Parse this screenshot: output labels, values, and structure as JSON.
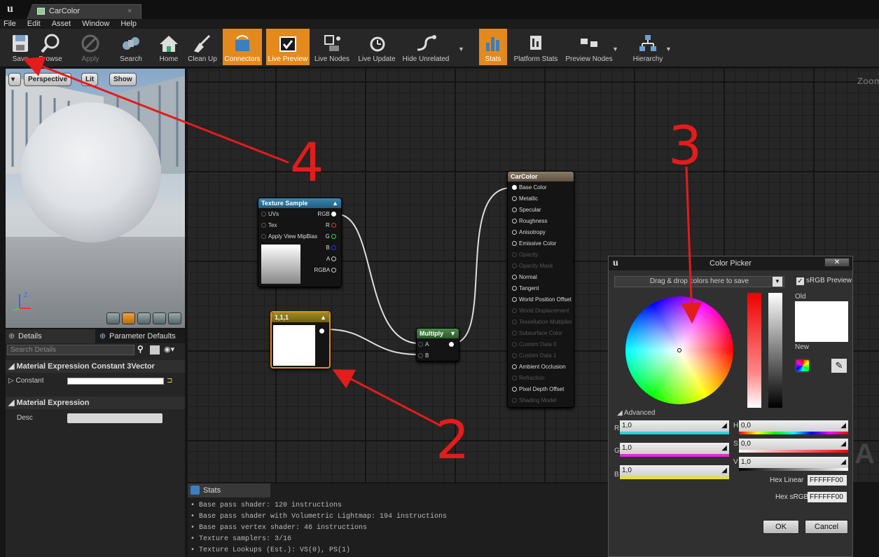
{
  "window": {
    "tab_title": "CarColor",
    "close_glyph": "×"
  },
  "menu": [
    "File",
    "Edit",
    "Asset",
    "Window",
    "Help"
  ],
  "toolbar": {
    "buttons": [
      {
        "label": "Save",
        "icon": "save-icon",
        "active": false
      },
      {
        "label": "Browse",
        "icon": "browse-icon",
        "active": false
      },
      {
        "label": "Apply",
        "icon": "apply-icon",
        "active": false,
        "disabled": true
      },
      {
        "label": "Search",
        "icon": "search-icon",
        "active": false
      },
      {
        "label": "Home",
        "icon": "home-icon",
        "active": false
      },
      {
        "label": "Clean Up",
        "icon": "clean-up-icon",
        "active": false
      },
      {
        "label": "Connectors",
        "icon": "connectors-icon",
        "active": true
      },
      {
        "label": "Live Preview",
        "icon": "live-preview-icon",
        "active": true
      },
      {
        "label": "Live Nodes",
        "icon": "live-nodes-icon",
        "active": false
      },
      {
        "label": "Live Update",
        "icon": "live-update-icon",
        "active": false
      },
      {
        "label": "Hide Unrelated",
        "icon": "hide-unrelated-icon",
        "active": false
      },
      {
        "label": "Stats",
        "icon": "stats-icon",
        "active": true
      },
      {
        "label": "Platform Stats",
        "icon": "platform-stats-icon",
        "active": false
      },
      {
        "label": "Preview Nodes",
        "icon": "preview-nodes-icon",
        "active": false
      },
      {
        "label": "Hierarchy",
        "icon": "hierarchy-icon",
        "active": false
      }
    ]
  },
  "viewport": {
    "perspective": "Perspective",
    "lit": "Lit",
    "show": "Show",
    "axis_z": "Z"
  },
  "details": {
    "tab_details": "Details",
    "tab_params": "Parameter Defaults",
    "search_placeholder": "Search Details",
    "section1": "Material Expression Constant 3Vector",
    "constant_label": "Constant",
    "section2": "Material Expression",
    "desc_label": "Desc"
  },
  "graph": {
    "zoom_label": "Zoom",
    "texture_node": {
      "title": "Texture Sample",
      "inputs": [
        "UVs",
        "Tex",
        "Apply View MipBias"
      ],
      "outputs": [
        "RGB",
        "R",
        "G",
        "B",
        "A",
        "RGBA"
      ]
    },
    "const_node": {
      "title": "1,1,1"
    },
    "multiply_node": {
      "title": "Multiply",
      "inputs": [
        "A",
        "B"
      ]
    },
    "material_node": {
      "title": "CarColor",
      "pins": [
        {
          "label": "Base Color",
          "enabled": true
        },
        {
          "label": "Metallic",
          "enabled": true
        },
        {
          "label": "Specular",
          "enabled": true
        },
        {
          "label": "Roughness",
          "enabled": true
        },
        {
          "label": "Anisotropy",
          "enabled": true
        },
        {
          "label": "Emissive Color",
          "enabled": true
        },
        {
          "label": "Opacity",
          "enabled": false
        },
        {
          "label": "Opacity Mask",
          "enabled": false
        },
        {
          "label": "Normal",
          "enabled": true
        },
        {
          "label": "Tangent",
          "enabled": true
        },
        {
          "label": "World Position Offset",
          "enabled": true
        },
        {
          "label": "World Displacement",
          "enabled": false
        },
        {
          "label": "Tessellation Multiplier",
          "enabled": false
        },
        {
          "label": "Subsurface Color",
          "enabled": false
        },
        {
          "label": "Custom Data 0",
          "enabled": false
        },
        {
          "label": "Custom Data 1",
          "enabled": false
        },
        {
          "label": "Ambient Occlusion",
          "enabled": true
        },
        {
          "label": "Refraction",
          "enabled": false
        },
        {
          "label": "Pixel Depth Offset",
          "enabled": true
        },
        {
          "label": "Shading Model",
          "enabled": false
        }
      ]
    }
  },
  "stats": {
    "tab": "Stats",
    "lines": [
      "• Base pass shader: 120 instructions",
      "• Base pass shader with Volumetric Lightmap: 194 instructions",
      "• Base pass vertex shader: 46 instructions",
      "• Texture samplers: 3/16",
      "• Texture Lookups (Est.): VS(0), PS(1)"
    ]
  },
  "picker": {
    "title": "Color Picker",
    "close": "✕",
    "drop_hint": "Drag & drop colors here to save",
    "srgb_preview": "sRGB Preview",
    "old": "Old",
    "new": "New",
    "advanced": "Advanced",
    "r": {
      "label": "R",
      "value": "1,0"
    },
    "g": {
      "label": "G",
      "value": "1,0"
    },
    "b": {
      "label": "B",
      "value": "1,0"
    },
    "h": {
      "label": "H",
      "value": "0,0"
    },
    "s": {
      "label": "S",
      "value": "0,0"
    },
    "v": {
      "label": "V",
      "value": "1,0"
    },
    "hex_linear_label": "Hex Linear",
    "hex_linear": "FFFFFF00",
    "hex_srgb_label": "Hex sRGB",
    "hex_srgb": "FFFFFF00",
    "ok": "OK",
    "cancel": "Cancel"
  },
  "annotations": [
    "4",
    "3",
    "2"
  ],
  "colors": {
    "accent": "#e48a1d",
    "annotation": "#e31c1c",
    "texture_header": "#2b6f94",
    "const_header": "#8b7a1e",
    "multiply_header": "#3b6e3b",
    "material_header": "#7a6a58"
  }
}
